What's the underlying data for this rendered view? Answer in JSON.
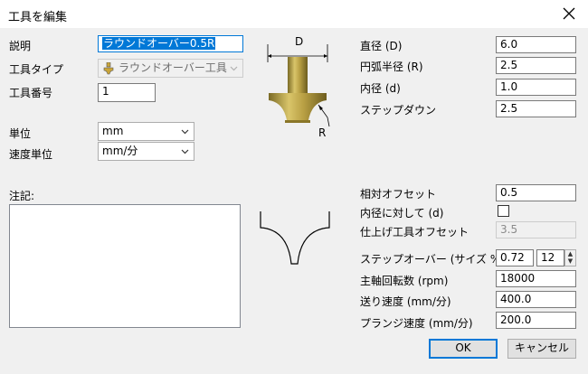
{
  "window": {
    "title": "工具を編集"
  },
  "left": {
    "description_label": "説明",
    "description_value": "ラウンドオーバー0.5R",
    "tool_type_label": "工具タイプ",
    "tool_type_value": "ラウンドオーバー工具",
    "tool_number_label": "工具番号",
    "tool_number_value": "1",
    "unit_label": "単位",
    "unit_value": "mm",
    "feed_unit_label": "速度単位",
    "feed_unit_value": "mm/分",
    "notes_label": "注記:",
    "notes_value": ""
  },
  "diagram": {
    "d_label": "D",
    "r_label": "R"
  },
  "params": {
    "diameter_label": "直径 (D)",
    "diameter_value": "6.0",
    "arc_radius_label": "円弧半径 (R)",
    "arc_radius_value": "2.5",
    "inner_diameter_label": "内径 (d)",
    "inner_diameter_value": "1.0",
    "stepdown_label": "ステップダウン",
    "stepdown_value": "2.5",
    "relative_offset_label": "相対オフセット",
    "relative_offset_value": "0.5",
    "relative_to_inner_label": "内径に対して (d)",
    "finish_offset_label": "仕上げ工具オフセット",
    "finish_offset_value": "3.5",
    "stepover_label": "ステップオーバー (サイズ % / D)",
    "stepover_value": "0.72",
    "stepover_percent": "12",
    "spindle_label": "主軸回転数 (rpm)",
    "spindle_value": "18000",
    "feed_label": "送り速度 (mm/分)",
    "feed_value": "400.0",
    "plunge_label": "プランジ速度 (mm/分)",
    "plunge_value": "200.0"
  },
  "buttons": {
    "ok": "OK",
    "cancel": "キャンセル"
  },
  "colors": {
    "accent": "#0078d7",
    "tool_gold": "#b39a3c"
  },
  "icons": {
    "tool_type": "roundover-tool-icon",
    "close": "close-icon",
    "dropdown": "chevron-down-icon"
  }
}
